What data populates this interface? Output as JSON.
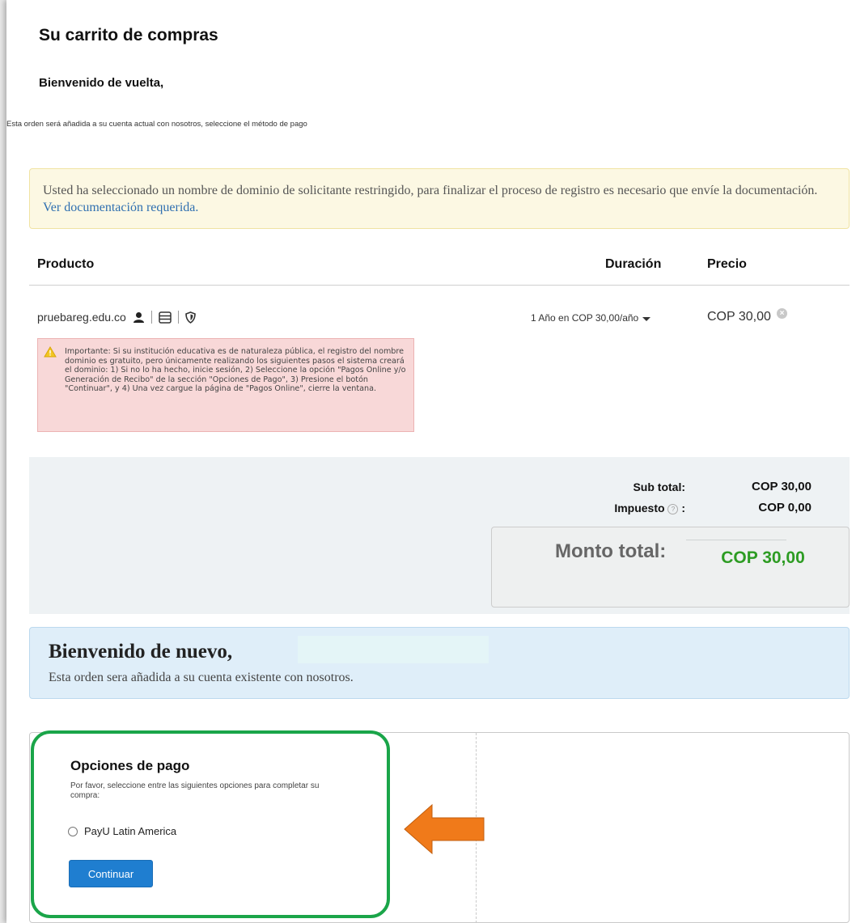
{
  "page_title": "Su carrito de compras",
  "greeting": "Bienvenido de vuelta,",
  "order_note": "Esta orden será añadida a su cuenta actual con nosotros, seleccione el método de pago",
  "restricted_alert": {
    "text": "Usted ha seleccionado un nombre de dominio de solicitante restringido, para finalizar el proceso de registro es necesario que envíe la documentación.",
    "link": "Ver documentación requerida."
  },
  "table": {
    "headers": {
      "product": "Producto",
      "duration": "Duración",
      "price": "Precio"
    },
    "item": {
      "domain": "pruebareg.edu.co",
      "icons": [
        "user-icon",
        "server-icon",
        "shield-icon"
      ],
      "duration": "1 Año en COP 30,00/año",
      "price": "COP 30,00",
      "remove_icon": "close-icon"
    }
  },
  "important_notice": "Importante: Si su institución educativa es de naturaleza pública, el registro del nombre dominio es gratuito, pero únicamente realizando los siguientes pasos el sistema creará el dominio: 1) Si no lo ha hecho, inicie sesión, 2) Seleccione la opción \"Pagos Online y/o Generación de Recibo\" de la sección \"Opciones de Pago\", 3) Presione el botón \"Continuar\", y 4) Una vez cargue la página de \"Pagos Online\", cierre la ventana.",
  "totals": {
    "subtotal_label": "Sub total:",
    "subtotal_value": "COP 30,00",
    "tax_label": "Impuesto",
    "tax_colon": ":",
    "tax_value": "COP 0,00",
    "total_label": "Monto total:",
    "total_value": "COP 30,00",
    "total_color": "#2d9c23"
  },
  "welcome": {
    "title": "Bienvenido de nuevo,",
    "text": "Esta orden sera añadida a su cuenta existente con nosotros."
  },
  "payment": {
    "title": "Opciones de pago",
    "description": "Por favor, seleccione entre las siguientes opciones para completar su compra:",
    "option": "PayU Latin America",
    "option_selected": false,
    "continue_label": "Continuar",
    "button_color": "#1f7ed0"
  },
  "annotation": {
    "highlight_color": "#1aa549",
    "arrow_color": "#f07a1a"
  }
}
